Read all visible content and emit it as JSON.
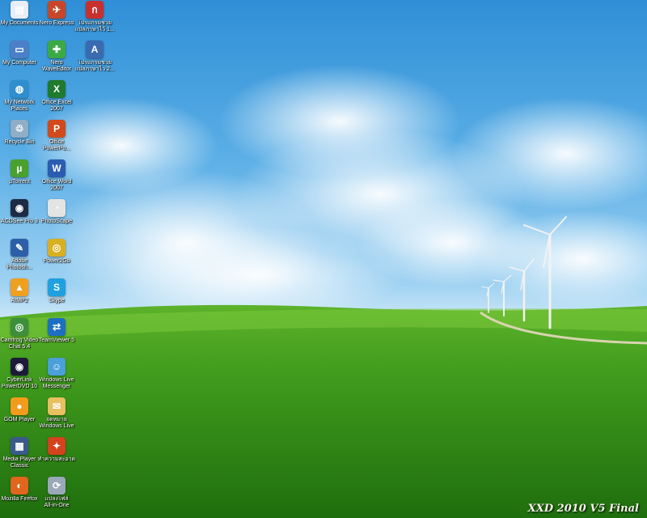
{
  "desktop": {
    "watermark": "XXD 2010 V5 Final",
    "columns": [
      [
        {
          "label": "My Documents",
          "icon": "folder-documents-icon",
          "color": "#e8eef7"
        },
        {
          "label": "My Computer",
          "icon": "computer-icon",
          "color": "#4d7fc9"
        },
        {
          "label": "My Network\nPlaces",
          "icon": "network-icon",
          "color": "#2e8fcf"
        },
        {
          "label": "Recycle Bin",
          "icon": "recycle-bin-icon",
          "color": "#8faec7"
        },
        {
          "label": "µTorrent",
          "icon": "utorrent-icon",
          "color": "#4aa02c"
        },
        {
          "label": "ACDSee Pro 3",
          "icon": "acdsee-icon",
          "color": "#1d2a44"
        },
        {
          "label": "Adobe\nPhotosh...",
          "icon": "photoshop-icon",
          "color": "#2d5fa8"
        },
        {
          "label": "AIMP2",
          "icon": "aimp-icon",
          "color": "#f0a020"
        },
        {
          "label": "Camfrog Video\nChat 5.4",
          "icon": "camfrog-icon",
          "color": "#3e8f3c"
        },
        {
          "label": "CyberLink\nPowerDVD 10",
          "icon": "powerdvd-icon",
          "color": "#1c1c3a"
        },
        {
          "label": "GOM Player",
          "icon": "gom-player-icon",
          "color": "#f29b1d"
        },
        {
          "label": "Media Player\nClassic",
          "icon": "media-player-classic-icon",
          "color": "#3a5a8c"
        },
        {
          "label": "Mozilla Firefox",
          "icon": "firefox-icon",
          "color": "#e0661d"
        }
      ],
      [
        {
          "label": "Nero Express",
          "icon": "nero-express-icon",
          "color": "#c8462a"
        },
        {
          "label": "Nero\nWaveEditor",
          "icon": "nero-waveeditor-icon",
          "color": "#3caa44"
        },
        {
          "label": "Office Excel\n2007",
          "icon": "excel-icon",
          "color": "#1f7a2e"
        },
        {
          "label": "Office\nPowerPo...",
          "icon": "powerpoint-icon",
          "color": "#d24a1b"
        },
        {
          "label": "Office Word\n2007",
          "icon": "word-icon",
          "color": "#2a5db0"
        },
        {
          "label": "PhotoScape",
          "icon": "photoscape-icon",
          "color": "#e4e4e4"
        },
        {
          "label": "Power2Go",
          "icon": "power2go-icon",
          "color": "#d8b020"
        },
        {
          "label": "Skype",
          "icon": "skype-icon",
          "color": "#1fa0e0"
        },
        {
          "label": "TeamViewer 5",
          "icon": "teamviewer-icon",
          "color": "#1d6fc2"
        },
        {
          "label": "Windows Live\nMessenger",
          "icon": "messenger-icon",
          "color": "#4aa0d8"
        },
        {
          "label": "จดหมาย\nWindows Live",
          "icon": "windows-live-mail-icon",
          "color": "#e8c060"
        },
        {
          "label": "ทำความสะอาด",
          "icon": "cleaner-icon",
          "color": "#d4421e"
        },
        {
          "label": "แปลงไฟล์\nAll-in-One",
          "icon": "converter-icon",
          "color": "#9aa8b8"
        }
      ],
      [
        {
          "label": "โปรแกรมช่วย\nแปลภาษาไว้ 1...",
          "icon": "translator-icon",
          "color": "#c83030"
        },
        {
          "label": "โปรแกรมช่วย\nแปลภาษาไว 2...",
          "icon": "dictionary-icon",
          "color": "#3a6ab0"
        }
      ]
    ]
  }
}
